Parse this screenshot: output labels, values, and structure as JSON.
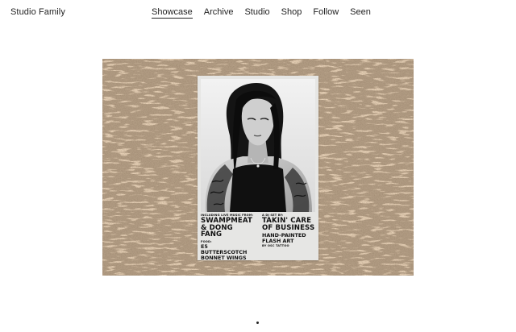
{
  "site": {
    "brand": "Studio Family"
  },
  "nav": {
    "items": [
      {
        "label": "Showcase",
        "active": true
      },
      {
        "label": "Archive",
        "active": false
      },
      {
        "label": "Studio",
        "active": false
      },
      {
        "label": "Shop",
        "active": false
      },
      {
        "label": "Follow",
        "active": false
      },
      {
        "label": "Seen",
        "active": false
      }
    ]
  },
  "showcase": {
    "background_color": "#e3cdb3",
    "poster": {
      "left": {
        "kicker": "Including live music from:",
        "headline_1": "Swampmeat",
        "headline_2": "& Dong Fang",
        "sub_kicker": "Food:",
        "sub_1": "E5 Butterscotch",
        "sub_2": "Bonnet Wings"
      },
      "right": {
        "kicker": "A DJ set by:",
        "headline_1": "Takin' Care",
        "headline_2": "of Business",
        "sub_1": "Hand-painted",
        "sub_2": "Flash Art",
        "credit": "by OSC Tattoo"
      }
    }
  },
  "pagination": {
    "current": 1,
    "total": 1
  }
}
